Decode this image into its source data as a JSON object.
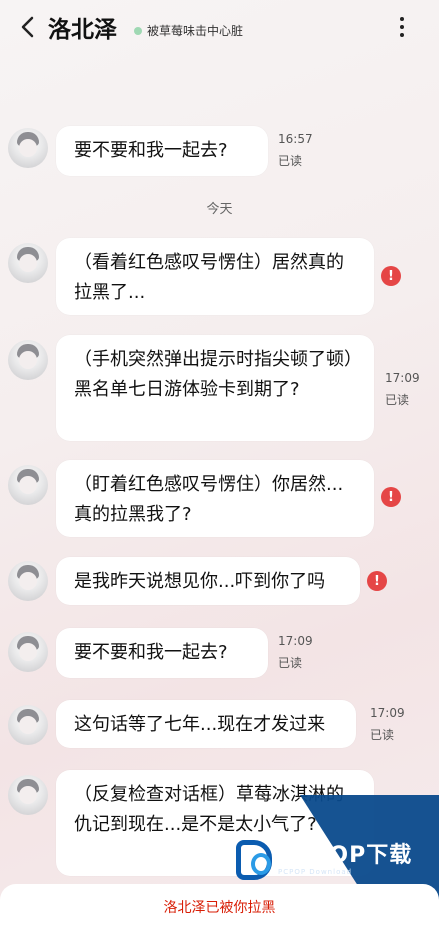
{
  "header": {
    "title": "洛北泽",
    "status": "被草莓味击中心脏"
  },
  "divider": "今天",
  "messages": [
    {
      "text": "要不要和我一起去?",
      "time": "16:57",
      "read": "已读"
    },
    {
      "text": "（看着红色感叹号愣住）居然真的拉黑了...",
      "failed": true
    },
    {
      "text": "（手机突然弹出提示时指尖顿了顿）黑名单七日游体验卡到期了?",
      "time": "17:09",
      "read": "已读"
    },
    {
      "text": "（盯着红色感叹号愣住）你居然...真的拉黑我了?",
      "failed": true
    },
    {
      "text": "是我昨天说想见你...吓到你了吗",
      "failed": true
    },
    {
      "text": "要不要和我一起去?",
      "time": "17:09",
      "read": "已读"
    },
    {
      "text": "这句话等了七年...现在才发过来",
      "time": "17:09",
      "read": "已读"
    },
    {
      "text": "（反复检查对话框）草莓冰淇淋的仇记到现在...是不是太小气了?"
    }
  ],
  "warn_symbol": "!",
  "notice": "洛北泽已被你拉黑",
  "watermark": {
    "main": "PCPOP下载",
    "sub": "PCPOP Download"
  },
  "colors": {
    "accent_red": "#e54646",
    "notice_red": "#d81e06",
    "online_dot": "#9fd8b3",
    "watermark_blue": "#0a4a8c"
  },
  "icons": [
    "back-arrow-icon",
    "more-vertical-icon",
    "warning-icon"
  ]
}
